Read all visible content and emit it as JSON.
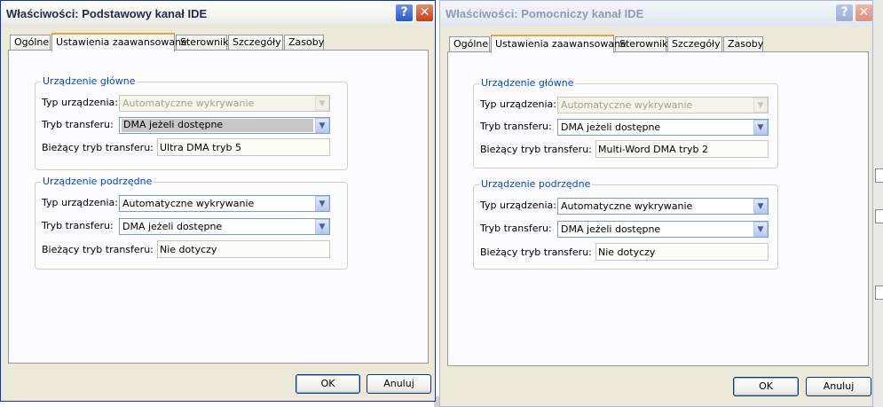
{
  "windows": [
    {
      "title": "Właściwości: Podstawowy kanał IDE",
      "help_glyph": "?",
      "close_glyph": "✕",
      "tabs": [
        "Ogólne",
        "Ustawienia zaawansowane",
        "Sterownik",
        "Szczegóły",
        "Zasoby"
      ],
      "active_tab": "Ustawienia zaawansowane",
      "primary": {
        "legend": "Urządzenie główne",
        "device_type_label": "Typ urządzenia:",
        "device_type_value": "Automatyczne wykrywanie",
        "device_type_enabled": false,
        "transfer_mode_label": "Tryb transferu:",
        "transfer_mode_value": "DMA jeżeli dostępne",
        "current_mode_label": "Bieżący tryb transferu:",
        "current_mode_value": "Ultra DMA tryb 5"
      },
      "secondary": {
        "legend": "Urządzenie podrzędne",
        "device_type_label": "Typ urządzenia:",
        "device_type_value": "Automatyczne wykrywanie",
        "transfer_mode_label": "Tryb transferu:",
        "transfer_mode_value": "DMA jeżeli dostępne",
        "current_mode_label": "Bieżący tryb transferu:",
        "current_mode_value": "Nie dotyczy"
      },
      "ok_label": "OK",
      "cancel_label": "Anuluj",
      "active": true
    },
    {
      "title": "Właściwości: Pomocniczy kanał IDE",
      "help_glyph": "?",
      "close_glyph": "✕",
      "tabs": [
        "Ogólne",
        "Ustawienia zaawansowane",
        "Sterownik",
        "Szczegóły",
        "Zasoby"
      ],
      "active_tab": "Ustawienia zaawansowane",
      "primary": {
        "legend": "Urządzenie główne",
        "device_type_label": "Typ urządzenia:",
        "device_type_value": "Automatyczne wykrywanie",
        "device_type_enabled": false,
        "transfer_mode_label": "Tryb transferu:",
        "transfer_mode_value": "DMA jeżeli dostępne",
        "current_mode_label": "Bieżący tryb transferu:",
        "current_mode_value": "Multi-Word DMA tryb 2"
      },
      "secondary": {
        "legend": "Urządzenie podrzędne",
        "device_type_label": "Typ urządzenia:",
        "device_type_value": "Automatyczne wykrywanie",
        "transfer_mode_label": "Tryb transferu:",
        "transfer_mode_value": "DMA jeżeli dostępne",
        "current_mode_label": "Bieżący tryb transferu:",
        "current_mode_value": "Nie dotyczy"
      },
      "ok_label": "OK",
      "cancel_label": "Anuluj",
      "active": false
    }
  ],
  "icons": {
    "combo_arrow": "chevron-down-icon",
    "help": "help-icon",
    "close": "close-icon"
  },
  "colors": {
    "active_frame": "#0831d9",
    "inactive_frame": "#a9b8d9",
    "dialog_face": "#ece9d8",
    "group_legend": "#0046d5",
    "tab_highlight": "#e8a33b"
  }
}
